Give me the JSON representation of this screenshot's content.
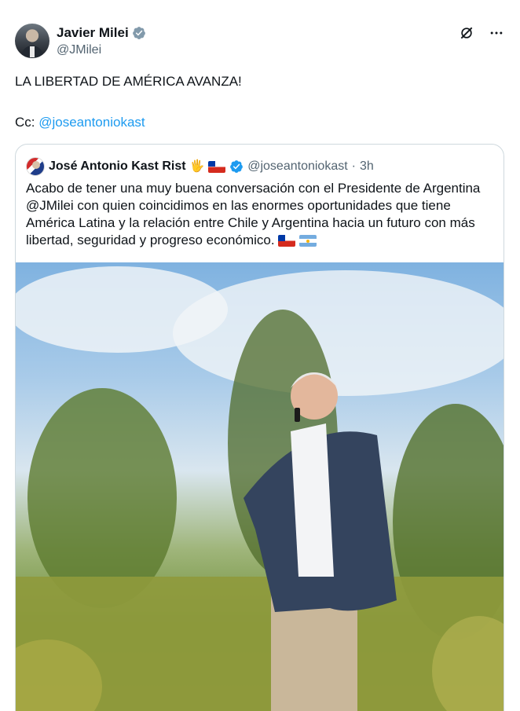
{
  "tweet": {
    "author": {
      "name": "Javier Milei",
      "handle": "@JMilei"
    },
    "text_line1": "LA LIBERTAD DE AMÉRICA AVANZA!",
    "cc_prefix": "Cc: ",
    "cc_mention": "@joseantoniokast"
  },
  "quote": {
    "author": {
      "name": "José Antonio Kast Rist",
      "emoji_hand": "🖐",
      "handle": "@joseantoniokast",
      "separator": "·",
      "time": "3h"
    },
    "text": "Acabo de tener una muy buena conversación con el Presidente de Argentina @JMilei con quien coincidimos en las enormes oportunidades que tiene América Latina y la relación entre Chile y Argentina hacia un futuro con más libertad, seguridad y progreso económico.",
    "photo_alt": ""
  },
  "colors": {
    "link": "#1d9bf0",
    "verified": "#1d9bf0",
    "text_secondary": "#536471",
    "border": "#cfd9de"
  },
  "icons": {
    "verified": "verified-badge-icon",
    "grok": "grok-icon",
    "more": "more-icon"
  }
}
